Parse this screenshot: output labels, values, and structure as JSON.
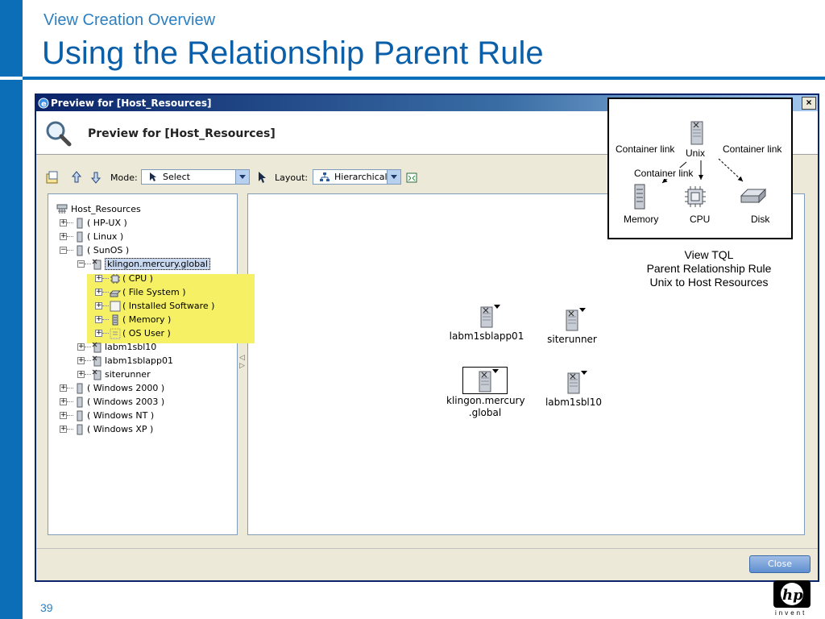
{
  "slide": {
    "subtitle": "View Creation Overview",
    "title": "Using the Relationship Parent Rule",
    "page_number": "39",
    "colors": {
      "accent_blue": "#0d6eb8",
      "title_blue": "#0b5fa8",
      "highlight_yellow": "#f5f064"
    },
    "logo_icon": "hp-invent-logo",
    "logo_text": "invent"
  },
  "dialog": {
    "window_title": "Preview for [Host_Resources]",
    "header_title": "Preview for [Host_Resources]",
    "close_x": "×",
    "toolbar": {
      "mode_label": "Mode:",
      "mode_value": "Select",
      "layout_label": "Layout:",
      "layout_value": "Hierarchical"
    },
    "close_button": "Close"
  },
  "tree": {
    "root": "Host_Resources",
    "items": [
      {
        "label": "( HP-UX )",
        "expander": "+"
      },
      {
        "label": "( Linux )",
        "expander": "+"
      },
      {
        "label": "( SunOS )",
        "expander": "−"
      },
      {
        "label": "klingon.mercury.global",
        "expander": "−"
      },
      {
        "label": "( CPU )",
        "expander": "+"
      },
      {
        "label": "( File System )",
        "expander": "+"
      },
      {
        "label": "( Installed Software )",
        "expander": "+"
      },
      {
        "label": "( Memory )",
        "expander": "+"
      },
      {
        "label": "( OS User )",
        "expander": "+"
      },
      {
        "label": "labm1sbl10",
        "expander": "+"
      },
      {
        "label": "labm1sblapp01",
        "expander": "+"
      },
      {
        "label": "siterunner",
        "expander": "+"
      },
      {
        "label": "( Windows 2000 )",
        "expander": "+"
      },
      {
        "label": "( Windows 2003 )",
        "expander": "+"
      },
      {
        "label": "( Windows NT )",
        "expander": "+"
      },
      {
        "label": "( Windows XP )",
        "expander": "+"
      }
    ]
  },
  "graph": {
    "nodes": [
      {
        "label": "labm1sblapp01"
      },
      {
        "label": "siterunner"
      },
      {
        "label": "klingon.mercury .global"
      },
      {
        "label": "labm1sbl10"
      }
    ]
  },
  "tql": {
    "labels": {
      "container_link_left": "Container link",
      "container_link_right": "Container link",
      "container_link_mid": "Container link",
      "unix": "Unix",
      "memory": "Memory",
      "cpu": "CPU",
      "disk": "Disk"
    },
    "caption": [
      "View TQL",
      "Parent Relationship Rule",
      "Unix to Host Resources"
    ]
  }
}
